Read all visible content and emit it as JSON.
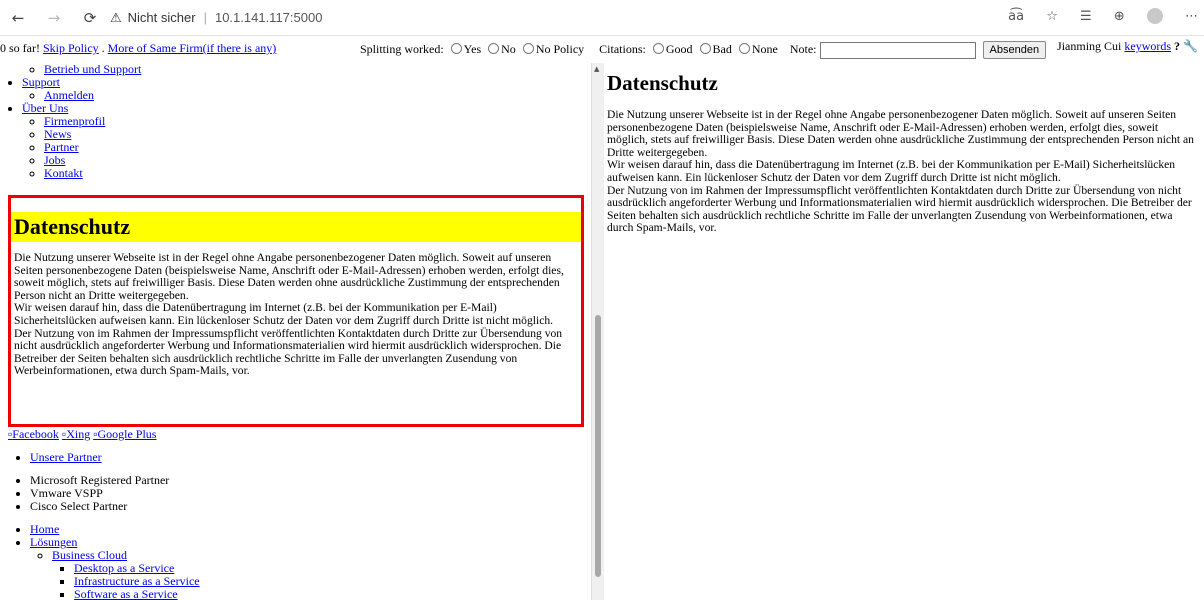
{
  "browser": {
    "security_label": "Nicht sicher",
    "url": "10.1.141.117:5000"
  },
  "labelbar": {
    "progress_text": "0 so far!",
    "skip_link": "Skip Policy",
    "sep": " . ",
    "more_link": "More of Same Firm(if there is any)",
    "splitting_label": "Splitting worked:",
    "opt_yes": "Yes",
    "opt_no": "No",
    "opt_no_policy": "No Policy",
    "citations_label": "Citations:",
    "opt_good": "Good",
    "opt_bad": "Bad",
    "opt_none": "None",
    "note_label": "Note:",
    "submit": "Absenden",
    "user": "Jianming Cui",
    "keywords_link": "keywords",
    "help": "?"
  },
  "left": {
    "nav_top": {
      "betrieb": "Betrieb und Support",
      "support": "Support",
      "anmelden": "Anmelden",
      "ueber_uns": "Über Uns",
      "firmenprofil": "Firmenprofil",
      "news": "News",
      "partner": "Partner",
      "jobs": "Jobs",
      "kontakt": "Kontakt"
    },
    "section_title": "Datenschutz",
    "p1": "Die Nutzung unserer Webseite ist in der Regel ohne Angabe personenbezogener Daten möglich. Soweit auf unseren Seiten personenbezogene Daten (beispielsweise Name, Anschrift oder E-Mail-Adressen) erhoben werden, erfolgt dies, soweit möglich, stets auf freiwilliger Basis. Diese Daten werden ohne ausdrückliche Zustimmung der entsprechenden Person nicht an Dritte weitergegeben.",
    "p2": "Wir weisen darauf hin, dass die Datenübertragung im Internet (z.B. bei der Kommunikation per E-Mail) Sicherheitslücken aufweisen kann. Ein lückenloser Schutz der Daten vor dem Zugriff durch Dritte ist nicht möglich.",
    "p3": "Der Nutzung von im Rahmen der Impressumspflicht veröffentlichten Kontaktdaten durch Dritte zur Übersendung von nicht ausdrücklich angeforderter Werbung und Informationsmaterialien wird hiermit ausdrücklich widersprochen. Die Betreiber der Seiten behalten sich ausdrücklich rechtliche Schritte im Falle der unverlangten Zusendung von Werbeinformationen, etwa durch Spam-Mails, vor.",
    "social": {
      "facebook": "Facebook",
      "xing": "Xing",
      "google_plus": "Google Plus"
    },
    "unsere_partner": "Unsere Partner",
    "partners": [
      "Microsoft Registered Partner",
      "Vmware VSPP",
      "Cisco Select Partner"
    ],
    "nav_bottom": {
      "home": "Home",
      "loesungen": "Lösungen",
      "business_cloud": "Business Cloud",
      "daas": "Desktop as a Service",
      "iaas": "Infrastructure as a Service",
      "saas": "Software as a Service"
    }
  },
  "right": {
    "title": "Datenschutz",
    "p1": "Die Nutzung unserer Webseite ist in der Regel ohne Angabe personenbezogener Daten möglich. Soweit auf unseren Seiten personenbezogene Daten (beispielsweise Name, Anschrift oder E-Mail-Adressen) erhoben werden, erfolgt dies, soweit möglich, stets auf freiwilliger Basis. Diese Daten werden ohne ausdrückliche Zustimmung der entsprechenden Person nicht an Dritte weitergegeben.",
    "p2": "Wir weisen darauf hin, dass die Datenübertragung im Internet (z.B. bei der Kommunikation per E-Mail) Sicherheitslücken aufweisen kann. Ein lückenloser Schutz der Daten vor dem Zugriff durch Dritte ist nicht möglich.",
    "p3": "Der Nutzung von im Rahmen der Impressumspflicht veröffentlichten Kontaktdaten durch Dritte zur Übersendung von nicht ausdrücklich angeforderter Werbung und Informationsmaterialien wird hiermit ausdrücklich widersprochen. Die Betreiber der Seiten behalten sich ausdrücklich rechtliche Schritte im Falle der unverlangten Zusendung von Werbeinformationen, etwa durch Spam-Mails, vor."
  },
  "colors": {
    "highlight_box": "#ee0000",
    "highlight_heading_bg": "#ffff00",
    "link": "#0000ee"
  }
}
